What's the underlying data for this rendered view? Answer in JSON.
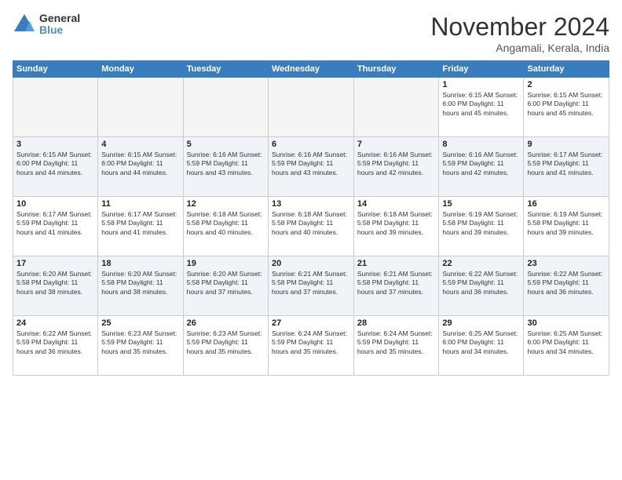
{
  "logo": {
    "line1": "General",
    "line2": "Blue"
  },
  "title": "November 2024",
  "subtitle": "Angamali, Kerala, India",
  "weekdays": [
    "Sunday",
    "Monday",
    "Tuesday",
    "Wednesday",
    "Thursday",
    "Friday",
    "Saturday"
  ],
  "weeks": [
    [
      {
        "day": "",
        "text": ""
      },
      {
        "day": "",
        "text": ""
      },
      {
        "day": "",
        "text": ""
      },
      {
        "day": "",
        "text": ""
      },
      {
        "day": "",
        "text": ""
      },
      {
        "day": "1",
        "text": "Sunrise: 6:15 AM\nSunset: 6:00 PM\nDaylight: 11 hours\nand 45 minutes."
      },
      {
        "day": "2",
        "text": "Sunrise: 6:15 AM\nSunset: 6:00 PM\nDaylight: 11 hours\nand 45 minutes."
      }
    ],
    [
      {
        "day": "3",
        "text": "Sunrise: 6:15 AM\nSunset: 6:00 PM\nDaylight: 11 hours\nand 44 minutes."
      },
      {
        "day": "4",
        "text": "Sunrise: 6:15 AM\nSunset: 6:00 PM\nDaylight: 11 hours\nand 44 minutes."
      },
      {
        "day": "5",
        "text": "Sunrise: 6:16 AM\nSunset: 5:59 PM\nDaylight: 11 hours\nand 43 minutes."
      },
      {
        "day": "6",
        "text": "Sunrise: 6:16 AM\nSunset: 5:59 PM\nDaylight: 11 hours\nand 43 minutes."
      },
      {
        "day": "7",
        "text": "Sunrise: 6:16 AM\nSunset: 5:59 PM\nDaylight: 11 hours\nand 42 minutes."
      },
      {
        "day": "8",
        "text": "Sunrise: 6:16 AM\nSunset: 5:59 PM\nDaylight: 11 hours\nand 42 minutes."
      },
      {
        "day": "9",
        "text": "Sunrise: 6:17 AM\nSunset: 5:59 PM\nDaylight: 11 hours\nand 41 minutes."
      }
    ],
    [
      {
        "day": "10",
        "text": "Sunrise: 6:17 AM\nSunset: 5:59 PM\nDaylight: 11 hours\nand 41 minutes."
      },
      {
        "day": "11",
        "text": "Sunrise: 6:17 AM\nSunset: 5:58 PM\nDaylight: 11 hours\nand 41 minutes."
      },
      {
        "day": "12",
        "text": "Sunrise: 6:18 AM\nSunset: 5:58 PM\nDaylight: 11 hours\nand 40 minutes."
      },
      {
        "day": "13",
        "text": "Sunrise: 6:18 AM\nSunset: 5:58 PM\nDaylight: 11 hours\nand 40 minutes."
      },
      {
        "day": "14",
        "text": "Sunrise: 6:18 AM\nSunset: 5:58 PM\nDaylight: 11 hours\nand 39 minutes."
      },
      {
        "day": "15",
        "text": "Sunrise: 6:19 AM\nSunset: 5:58 PM\nDaylight: 11 hours\nand 39 minutes."
      },
      {
        "day": "16",
        "text": "Sunrise: 6:19 AM\nSunset: 5:58 PM\nDaylight: 11 hours\nand 39 minutes."
      }
    ],
    [
      {
        "day": "17",
        "text": "Sunrise: 6:20 AM\nSunset: 5:58 PM\nDaylight: 11 hours\nand 38 minutes."
      },
      {
        "day": "18",
        "text": "Sunrise: 6:20 AM\nSunset: 5:58 PM\nDaylight: 11 hours\nand 38 minutes."
      },
      {
        "day": "19",
        "text": "Sunrise: 6:20 AM\nSunset: 5:58 PM\nDaylight: 11 hours\nand 37 minutes."
      },
      {
        "day": "20",
        "text": "Sunrise: 6:21 AM\nSunset: 5:58 PM\nDaylight: 11 hours\nand 37 minutes."
      },
      {
        "day": "21",
        "text": "Sunrise: 6:21 AM\nSunset: 5:58 PM\nDaylight: 11 hours\nand 37 minutes."
      },
      {
        "day": "22",
        "text": "Sunrise: 6:22 AM\nSunset: 5:59 PM\nDaylight: 11 hours\nand 36 minutes."
      },
      {
        "day": "23",
        "text": "Sunrise: 6:22 AM\nSunset: 5:59 PM\nDaylight: 11 hours\nand 36 minutes."
      }
    ],
    [
      {
        "day": "24",
        "text": "Sunrise: 6:22 AM\nSunset: 5:59 PM\nDaylight: 11 hours\nand 36 minutes."
      },
      {
        "day": "25",
        "text": "Sunrise: 6:23 AM\nSunset: 5:59 PM\nDaylight: 11 hours\nand 35 minutes."
      },
      {
        "day": "26",
        "text": "Sunrise: 6:23 AM\nSunset: 5:59 PM\nDaylight: 11 hours\nand 35 minutes."
      },
      {
        "day": "27",
        "text": "Sunrise: 6:24 AM\nSunset: 5:59 PM\nDaylight: 11 hours\nand 35 minutes."
      },
      {
        "day": "28",
        "text": "Sunrise: 6:24 AM\nSunset: 5:59 PM\nDaylight: 11 hours\nand 35 minutes."
      },
      {
        "day": "29",
        "text": "Sunrise: 6:25 AM\nSunset: 6:00 PM\nDaylight: 11 hours\nand 34 minutes."
      },
      {
        "day": "30",
        "text": "Sunrise: 6:25 AM\nSunset: 6:00 PM\nDaylight: 11 hours\nand 34 minutes."
      }
    ]
  ]
}
